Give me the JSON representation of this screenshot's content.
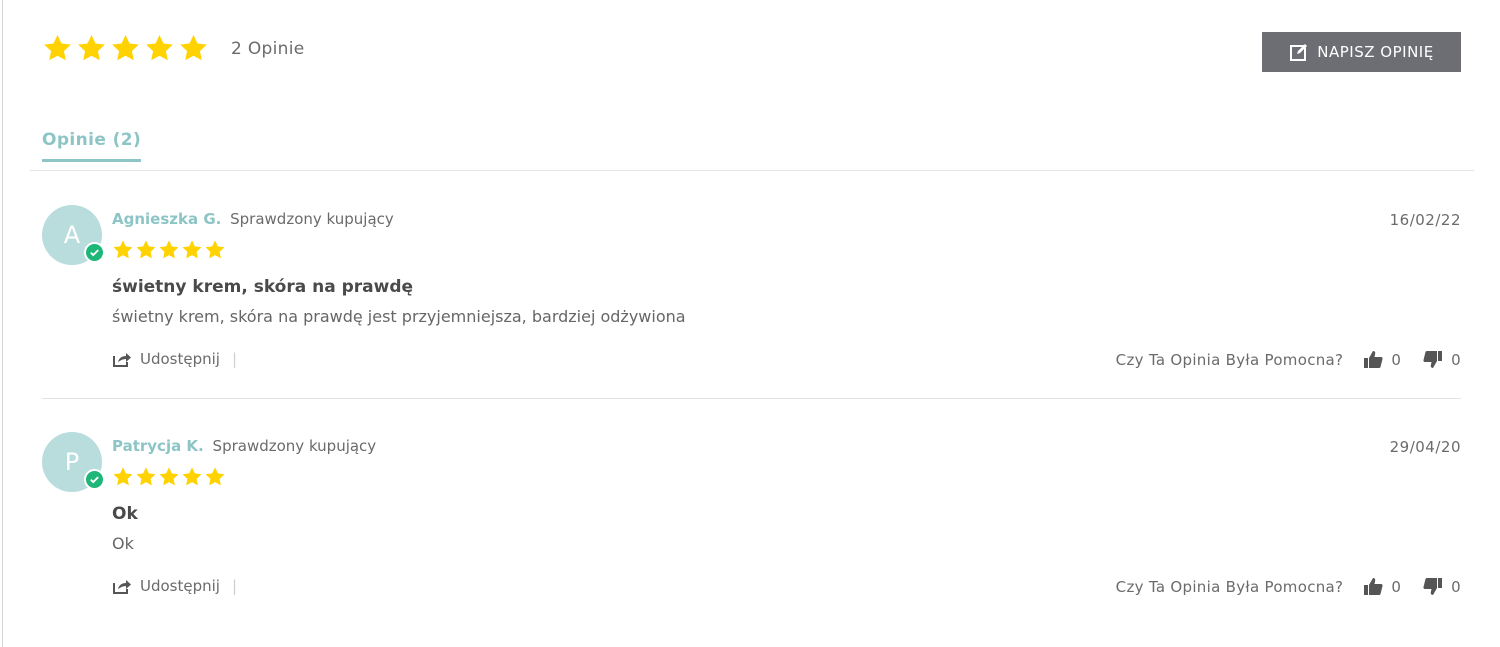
{
  "summary": {
    "stars": [
      1,
      1,
      1,
      1,
      1
    ],
    "count_label": "2 Opinie"
  },
  "write_button": {
    "label": "NAPISZ OPINIĘ",
    "icon": "edit-icon"
  },
  "tab": {
    "label": "Opinie (2)"
  },
  "reviews": [
    {
      "initial": "A",
      "author": "Agnieszka G.",
      "verified_label": "Sprawdzony kupujący",
      "date": "16/02/22",
      "rating": 5,
      "title": "świetny krem, skóra na prawdę",
      "body": "świetny krem, skóra na prawdę jest przyjemniejsza, bardziej odżywiona",
      "share_label": "Udostępnij",
      "separator": "|",
      "helpful_question": "Czy Ta Opinia Była Pomocna?",
      "upvotes": "0",
      "downvotes": "0"
    },
    {
      "initial": "P",
      "author": "Patrycja K.",
      "verified_label": "Sprawdzony kupujący",
      "date": "29/04/20",
      "rating": 5,
      "title": "Ok",
      "body": "Ok",
      "share_label": "Udostępnij",
      "separator": "|",
      "helpful_question": "Czy Ta Opinia Była Pomocna?",
      "upvotes": "0",
      "downvotes": "0"
    }
  ],
  "colors": {
    "star": "#ffd200",
    "accent": "#8dc5c6",
    "avatar_bg": "#b9dcdd",
    "verified": "#1fb67a",
    "button_bg": "#6d6e74"
  }
}
